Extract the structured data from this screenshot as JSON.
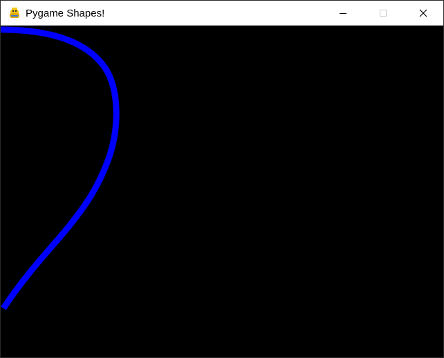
{
  "window": {
    "title": "Pygame Shapes!",
    "app_icon": "pygame-snake-icon",
    "controls": {
      "minimize_icon": "minimize-icon",
      "maximize_icon": "maximize-icon",
      "close_icon": "close-icon"
    }
  },
  "canvas": {
    "background_color": "#000000",
    "shape": {
      "kind": "curve",
      "color": "#0000ff"
    }
  }
}
